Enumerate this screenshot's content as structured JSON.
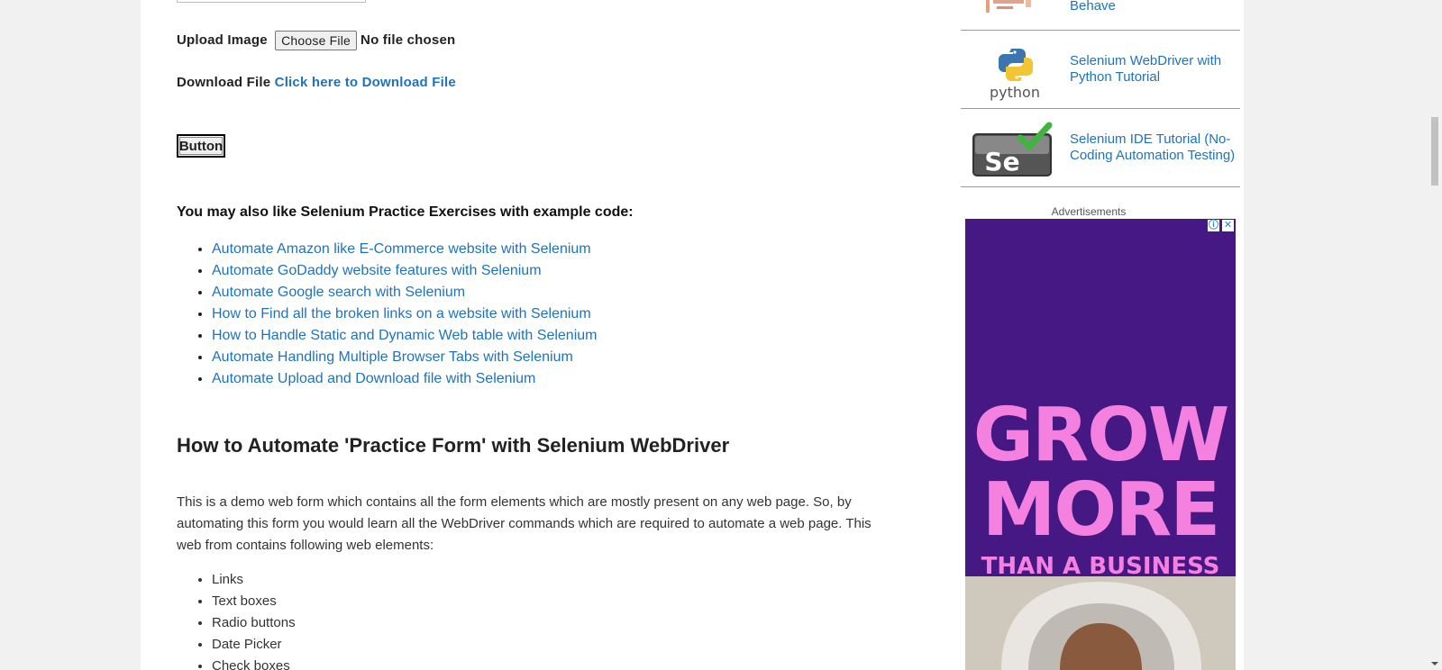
{
  "form": {
    "upload_label": "Upload Image",
    "choose_file_label": "Choose File",
    "no_file_text": "No file chosen",
    "download_label": "Download File",
    "download_link": "Click here to Download File",
    "button_label": "Button"
  },
  "also_like": {
    "heading": "You may also like Selenium Practice Exercises with example code:",
    "links": [
      "Automate Amazon like E-Commerce website with Selenium",
      "Automate GoDaddy website features with Selenium",
      "Automate Google search with Selenium",
      "How to Find all the broken links on a website with Selenium",
      "How to Handle Static and Dynamic Web table with Selenium",
      "Automate Handling Multiple Browser Tabs with Selenium",
      "Automate Upload and Download file with Selenium"
    ]
  },
  "article": {
    "heading": "How to Automate 'Practice Form' with Selenium WebDriver",
    "paragraph": "This is a demo web form which contains all the form elements which are mostly present on any web page. So, by automating this form you would learn all the WebDriver commands which are required to automate a web page. This web from contains following web elements:",
    "elements": [
      "Links",
      "Text boxes",
      "Radio buttons",
      "Date Picker",
      "Check boxes"
    ]
  },
  "sidebar": {
    "related": [
      {
        "title": "Behave",
        "icon": "selenium-wordcloud-thumbnail"
      },
      {
        "title": "Selenium WebDriver with Python Tutorial",
        "icon": "python-logo-thumbnail",
        "thumb_text": "python"
      },
      {
        "title": "Selenium IDE Tutorial (No-Coding Automation Testing)",
        "icon": "selenium-ide-logo-thumbnail",
        "thumb_text": "Se"
      }
    ],
    "ads_label": "Advertisements",
    "ad": {
      "line1": "GROW",
      "line2": "MORE",
      "line3": "THAN A BUSINESS",
      "info_icon": "ⓘ",
      "close_icon": "✕"
    }
  },
  "colors": {
    "link": "#1e73be",
    "ad_background": "#451884",
    "ad_text": "#f480e0"
  }
}
